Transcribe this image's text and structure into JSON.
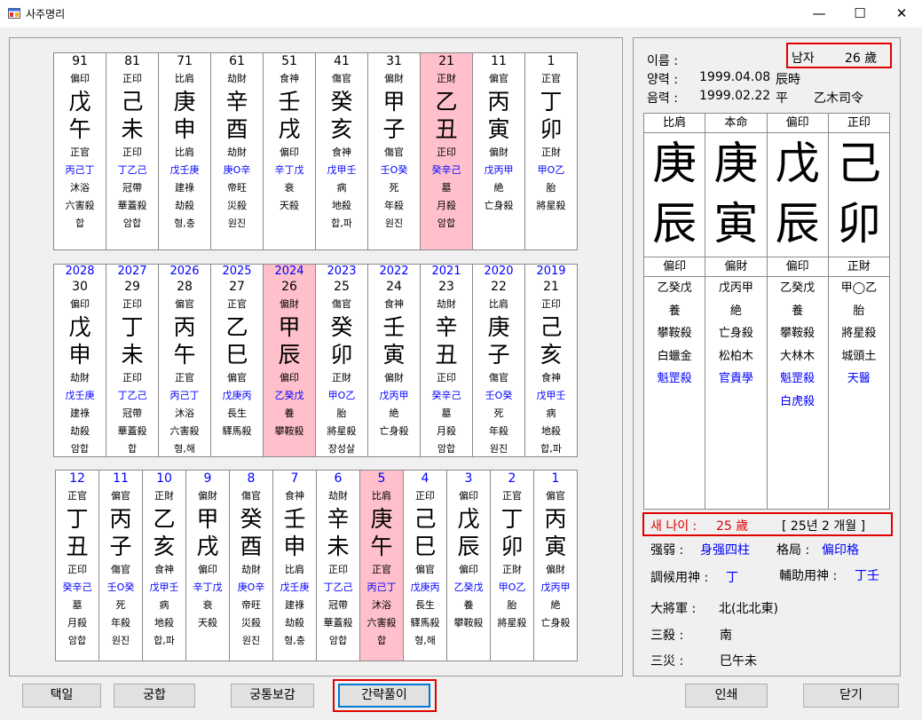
{
  "window": {
    "title": "사주명리",
    "minimize": "—",
    "maximize": "☐",
    "close": "✕"
  },
  "daewoon": [
    {
      "n": "91",
      "ss": "偏印",
      "g": "戊",
      "j": "午",
      "js": "正官",
      "hid": "丙己丁",
      "st": "沐浴",
      "s1": "六害殺",
      "r": "합"
    },
    {
      "n": "81",
      "ss": "正印",
      "g": "己",
      "j": "未",
      "js": "正印",
      "hid": "丁乙己",
      "st": "冠帶",
      "s1": "華蓋殺",
      "r": "암합"
    },
    {
      "n": "71",
      "ss": "比肩",
      "g": "庚",
      "j": "申",
      "js": "比肩",
      "hid": "戊壬庚",
      "st": "建祿",
      "s1": "劫殺",
      "r": "형,충"
    },
    {
      "n": "61",
      "ss": "劫財",
      "g": "辛",
      "j": "酉",
      "js": "劫財",
      "hid": "庚O辛",
      "st": "帝旺",
      "s1": "災殺",
      "r": "원진"
    },
    {
      "n": "51",
      "ss": "食神",
      "g": "壬",
      "j": "戌",
      "js": "偏印",
      "hid": "辛丁戊",
      "st": "衰",
      "s1": "天殺",
      "r": ""
    },
    {
      "n": "41",
      "ss": "傷官",
      "g": "癸",
      "j": "亥",
      "js": "食神",
      "hid": "戊甲壬",
      "st": "病",
      "s1": "地殺",
      "r": "합,파"
    },
    {
      "n": "31",
      "ss": "偏財",
      "g": "甲",
      "j": "子",
      "js": "傷官",
      "hid": "壬O癸",
      "st": "死",
      "s1": "年殺",
      "r": "원진"
    },
    {
      "n": "21",
      "ss": "正財",
      "g": "乙",
      "j": "丑",
      "js": "正印",
      "hid": "癸辛己",
      "st": "墓",
      "s1": "月殺",
      "r": "암합",
      "hl": true
    },
    {
      "n": "11",
      "ss": "偏官",
      "g": "丙",
      "j": "寅",
      "js": "偏財",
      "hid": "戊丙甲",
      "st": "絶",
      "s1": "亡身殺",
      "r": ""
    },
    {
      "n": "1",
      "ss": "正官",
      "g": "丁",
      "j": "卯",
      "js": "正財",
      "hid": "甲O乙",
      "st": "胎",
      "s1": "將星殺",
      "r": ""
    }
  ],
  "yearly": [
    {
      "y": "2028",
      "n": "30",
      "ss": "偏印",
      "g": "戊",
      "j": "申",
      "js": "劫財",
      "hid": "戊壬庚",
      "st": "建祿",
      "s1": "劫殺",
      "r": "암합"
    },
    {
      "y": "2027",
      "n": "29",
      "ss": "正印",
      "g": "丁",
      "j": "未",
      "js": "正印",
      "hid": "丁乙己",
      "st": "冠帶",
      "s1": "華蓋殺",
      "r": "합"
    },
    {
      "y": "2026",
      "n": "28",
      "ss": "偏官",
      "g": "丙",
      "j": "午",
      "js": "正官",
      "hid": "丙己丁",
      "st": "沐浴",
      "s1": "六害殺",
      "r": "형,해"
    },
    {
      "y": "2025",
      "n": "27",
      "ss": "正官",
      "g": "乙",
      "j": "巳",
      "js": "偏官",
      "hid": "戊庚丙",
      "st": "長生",
      "s1": "驛馬殺",
      "r": ""
    },
    {
      "y": "2024",
      "n": "26",
      "ss": "偏財",
      "g": "甲",
      "j": "辰",
      "js": "偏印",
      "hid": "乙癸戊",
      "st": "養",
      "s1": "攀鞍殺",
      "r": "",
      "hl": true
    },
    {
      "y": "2023",
      "n": "25",
      "ss": "傷官",
      "g": "癸",
      "j": "卯",
      "js": "正財",
      "hid": "甲O乙",
      "st": "胎",
      "s1": "將星殺",
      "r": "장성살"
    },
    {
      "y": "2022",
      "n": "24",
      "ss": "食神",
      "g": "壬",
      "j": "寅",
      "js": "偏財",
      "hid": "戊丙甲",
      "st": "絶",
      "s1": "亡身殺",
      "r": ""
    },
    {
      "y": "2021",
      "n": "23",
      "ss": "劫財",
      "g": "辛",
      "j": "丑",
      "js": "正印",
      "hid": "癸辛己",
      "st": "墓",
      "s1": "月殺",
      "r": "암합"
    },
    {
      "y": "2020",
      "n": "22",
      "ss": "比肩",
      "g": "庚",
      "j": "子",
      "js": "傷官",
      "hid": "壬O癸",
      "st": "死",
      "s1": "年殺",
      "r": "원진"
    },
    {
      "y": "2019",
      "n": "21",
      "ss": "正印",
      "g": "己",
      "j": "亥",
      "js": "食神",
      "hid": "戊甲壬",
      "st": "病",
      "s1": "地殺",
      "r": "합,파"
    }
  ],
  "monthly": [
    {
      "n": "12",
      "ss": "正官",
      "g": "丁",
      "j": "丑",
      "js": "正印",
      "hid": "癸辛己",
      "st": "墓",
      "s1": "月殺",
      "r": "암합"
    },
    {
      "n": "11",
      "ss": "偏官",
      "g": "丙",
      "j": "子",
      "js": "傷官",
      "hid": "壬O癸",
      "st": "死",
      "s1": "年殺",
      "r": "원진"
    },
    {
      "n": "10",
      "ss": "正財",
      "g": "乙",
      "j": "亥",
      "js": "食神",
      "hid": "戊甲壬",
      "st": "病",
      "s1": "地殺",
      "r": "합,파"
    },
    {
      "n": "9",
      "ss": "偏財",
      "g": "甲",
      "j": "戌",
      "js": "偏印",
      "hid": "辛丁戊",
      "st": "衰",
      "s1": "天殺",
      "r": ""
    },
    {
      "n": "8",
      "ss": "傷官",
      "g": "癸",
      "j": "酉",
      "js": "劫財",
      "hid": "庚O辛",
      "st": "帝旺",
      "s1": "災殺",
      "r": "원진"
    },
    {
      "n": "7",
      "ss": "食神",
      "g": "壬",
      "j": "申",
      "js": "比肩",
      "hid": "戊壬庚",
      "st": "建祿",
      "s1": "劫殺",
      "r": "형,충"
    },
    {
      "n": "6",
      "ss": "劫財",
      "g": "辛",
      "j": "未",
      "js": "正印",
      "hid": "丁乙己",
      "st": "冠帶",
      "s1": "華蓋殺",
      "r": "암합"
    },
    {
      "n": "5",
      "ss": "比肩",
      "g": "庚",
      "j": "午",
      "js": "正官",
      "hid": "丙己丁",
      "st": "沐浴",
      "s1": "六害殺",
      "r": "합",
      "hl": true
    },
    {
      "n": "4",
      "ss": "正印",
      "g": "己",
      "j": "巳",
      "js": "偏官",
      "hid": "戊庚丙",
      "st": "長生",
      "s1": "驛馬殺",
      "r": "형,해"
    },
    {
      "n": "3",
      "ss": "偏印",
      "g": "戊",
      "j": "辰",
      "js": "偏印",
      "hid": "乙癸戊",
      "st": "養",
      "s1": "攀鞍殺",
      "r": ""
    },
    {
      "n": "2",
      "ss": "正官",
      "g": "丁",
      "j": "卯",
      "js": "正財",
      "hid": "甲O乙",
      "st": "胎",
      "s1": "將星殺",
      "r": ""
    },
    {
      "n": "1",
      "ss": "偏官",
      "g": "丙",
      "j": "寅",
      "js": "偏財",
      "hid": "戊丙甲",
      "st": "絶",
      "s1": "亡身殺",
      "r": ""
    }
  ],
  "profile": {
    "name_label": "이름 :",
    "gender": "남자",
    "age": "26 歲",
    "solar_label": "양력 :",
    "solar_date": "1999.04.08",
    "solar_time": "辰時",
    "lunar_label": "음력 :",
    "lunar_date": "1999.02.22",
    "lunar_flag": "平",
    "lunar_extra": "乙木司令"
  },
  "pillars": [
    {
      "head": "比肩",
      "g": "庚",
      "j": "辰",
      "js": "偏印",
      "hid": "乙癸戊",
      "st": "養",
      "s1": "攀鞍殺",
      "s2": "白蠟金",
      "s3": "魁罡殺",
      "s4": ""
    },
    {
      "head": "本命",
      "g": "庚",
      "j": "寅",
      "js": "偏財",
      "hid": "戊丙甲",
      "st": "絶",
      "s1": "亡身殺",
      "s2": "松柏木",
      "s3": "官貴學",
      "s4": ""
    },
    {
      "head": "偏印",
      "g": "戊",
      "j": "辰",
      "js": "偏印",
      "hid": "乙癸戊",
      "st": "養",
      "s1": "攀鞍殺",
      "s2": "大林木",
      "s3": "魁罡殺",
      "s4": "白虎殺"
    },
    {
      "head": "正印",
      "g": "己",
      "j": "卯",
      "js": "正財",
      "hid": "甲◯乙",
      "st": "胎",
      "s1": "將星殺",
      "s2": "城頭土",
      "s3": "天醫",
      "s4": ""
    }
  ],
  "summary": {
    "new_age_label": "새 나이 :",
    "new_age_value": "25 歲",
    "new_age_detail": "[ 25년 2 개월 ]",
    "strength_label": "强弱 :",
    "strength_value": "身强四柱",
    "geok_label": "格局 :",
    "geok_value": "偏印格",
    "johu_label": "調候用神 :",
    "johu_value": "丁",
    "bojo_label": "輔助用神 :",
    "bojo_value": "丁壬",
    "daejang_label": "大將軍 :",
    "daejang_value": "北(北北東)",
    "samsal_label": "三殺 :",
    "samsal_value": "南",
    "samjae_label": "三災 :",
    "samjae_value": "巳午未"
  },
  "buttons": {
    "taekil": "택일",
    "gunghap": "궁합",
    "gungtong": "궁통보감",
    "ganrak": "간략풀이",
    "print": "인쇄",
    "close": "닫기"
  }
}
